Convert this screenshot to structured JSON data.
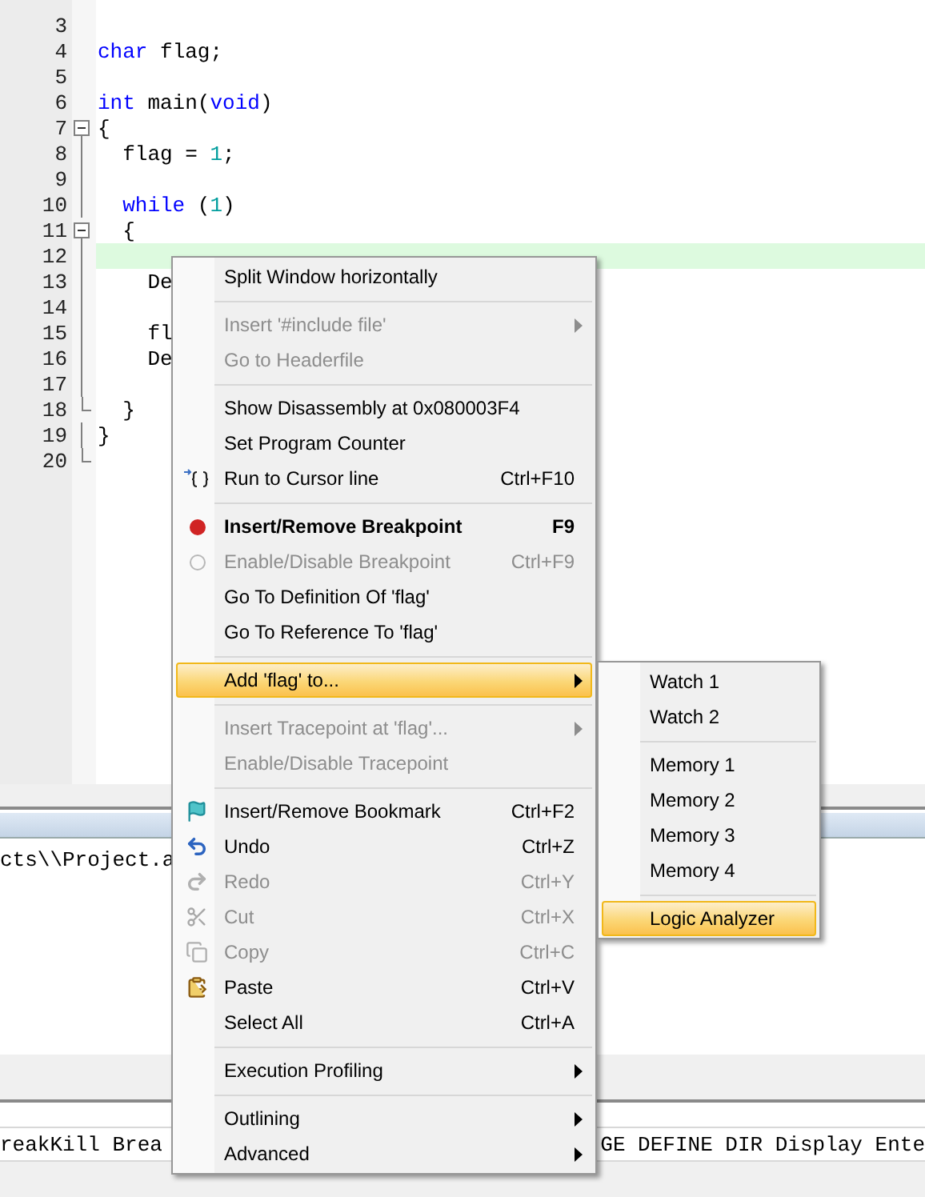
{
  "editor": {
    "lines": [
      {
        "number": "3",
        "highlighted": false
      },
      {
        "number": "4",
        "tokens": [
          {
            "kind": "kw",
            "text": "char"
          },
          {
            "kind": "plain",
            "text": " flag;"
          }
        ],
        "highlighted": false
      },
      {
        "number": "5",
        "highlighted": false
      },
      {
        "number": "6",
        "tokens": [
          {
            "kind": "kw",
            "text": "int"
          },
          {
            "kind": "plain",
            "text": " main("
          },
          {
            "kind": "kw",
            "text": "void"
          },
          {
            "kind": "plain",
            "text": ")"
          }
        ],
        "highlighted": false
      },
      {
        "number": "7",
        "tokens": [
          {
            "kind": "plain",
            "text": "{"
          }
        ],
        "fold_marker": {
          "kind": "toggle"
        },
        "highlighted": false
      },
      {
        "number": "8",
        "tokens": [
          {
            "kind": "plain",
            "text": "  flag = "
          },
          {
            "kind": "num",
            "text": "1"
          },
          {
            "kind": "plain",
            "text": ";"
          }
        ],
        "fold_marker": {
          "kind": "line"
        },
        "highlighted": false
      },
      {
        "number": "9",
        "fold_marker": {
          "kind": "line"
        },
        "highlighted": false
      },
      {
        "number": "10",
        "tokens": [
          {
            "kind": "kw",
            "text": "  while"
          },
          {
            "kind": "plain",
            "text": " ("
          },
          {
            "kind": "num",
            "text": "1"
          },
          {
            "kind": "plain",
            "text": ")"
          }
        ],
        "fold_marker": {
          "kind": "line"
        },
        "highlighted": false
      },
      {
        "number": "11",
        "tokens": [
          {
            "kind": "plain",
            "text": "  {"
          }
        ],
        "fold_marker": {
          "kind": "toggle"
        },
        "highlighted": false
      },
      {
        "number": "12",
        "fold_marker": {
          "kind": "line"
        },
        "highlighted": true
      },
      {
        "number": "13",
        "tokens": [
          {
            "kind": "plain",
            "text": "    De"
          }
        ],
        "fold_marker": {
          "kind": "line"
        },
        "highlighted": false
      },
      {
        "number": "14",
        "fold_marker": {
          "kind": "line"
        },
        "highlighted": false
      },
      {
        "number": "15",
        "tokens": [
          {
            "kind": "plain",
            "text": "    fl"
          }
        ],
        "fold_marker": {
          "kind": "line"
        },
        "highlighted": false
      },
      {
        "number": "16",
        "tokens": [
          {
            "kind": "plain",
            "text": "    De"
          }
        ],
        "fold_marker": {
          "kind": "line"
        },
        "highlighted": false
      },
      {
        "number": "17",
        "fold_marker": {
          "kind": "line"
        },
        "highlighted": false
      },
      {
        "number": "18",
        "tokens": [
          {
            "kind": "plain",
            "text": "  }"
          }
        ],
        "fold_marker": {
          "kind": "end"
        },
        "highlighted": false
      },
      {
        "number": "19",
        "tokens": [
          {
            "kind": "plain",
            "text": "}"
          }
        ],
        "fold_marker": {
          "kind": "line"
        },
        "highlighted": false
      },
      {
        "number": "20",
        "fold_marker": {
          "kind": "end"
        },
        "highlighted": false
      }
    ]
  },
  "output": {
    "text": "cts\\\\Project.a"
  },
  "command_line": {
    "left": "reakKill Brea",
    "right": "GE DEFINE DIR Display Ente"
  },
  "context_menu": {
    "items": [
      {
        "kind": "item",
        "label": "Split Window horizontally",
        "disabled": false,
        "selected": false,
        "bold": false,
        "submenu": false
      },
      {
        "kind": "separator"
      },
      {
        "kind": "item",
        "label": "Insert '#include file'",
        "disabled": true,
        "selected": false,
        "bold": false,
        "submenu": true
      },
      {
        "kind": "item",
        "label": "Go to Headerfile",
        "disabled": true,
        "selected": false,
        "bold": false,
        "submenu": false
      },
      {
        "kind": "separator"
      },
      {
        "kind": "item",
        "label": "Show Disassembly at 0x080003F4",
        "disabled": false,
        "selected": false,
        "bold": false,
        "submenu": false
      },
      {
        "kind": "item",
        "label": "Set Program Counter",
        "disabled": false,
        "selected": false,
        "bold": false,
        "submenu": false
      },
      {
        "kind": "item",
        "label": "Run to Cursor line",
        "shortcut": "Ctrl+F10",
        "disabled": false,
        "selected": false,
        "bold": false,
        "submenu": false
      },
      {
        "kind": "separator"
      },
      {
        "kind": "item",
        "label": "Insert/Remove Breakpoint",
        "shortcut": "F9",
        "disabled": false,
        "selected": false,
        "bold": true,
        "submenu": false
      },
      {
        "kind": "item",
        "label": "Enable/Disable Breakpoint",
        "shortcut": "Ctrl+F9",
        "disabled": true,
        "selected": false,
        "bold": false,
        "submenu": false
      },
      {
        "kind": "item",
        "label": "Go To Definition Of 'flag'",
        "disabled": false,
        "selected": false,
        "bold": false,
        "submenu": false
      },
      {
        "kind": "item",
        "label": "Go To Reference To 'flag'",
        "disabled": false,
        "selected": false,
        "bold": false,
        "submenu": false
      },
      {
        "kind": "separator"
      },
      {
        "kind": "item",
        "label": "Add 'flag' to...",
        "disabled": false,
        "selected": true,
        "bold": false,
        "submenu": true
      },
      {
        "kind": "separator"
      },
      {
        "kind": "item",
        "label": "Insert Tracepoint at 'flag'...",
        "disabled": true,
        "selected": false,
        "bold": false,
        "submenu": true
      },
      {
        "kind": "item",
        "label": "Enable/Disable Tracepoint",
        "disabled": true,
        "selected": false,
        "bold": false,
        "submenu": false
      },
      {
        "kind": "separator"
      },
      {
        "kind": "item",
        "label": "Insert/Remove Bookmark",
        "shortcut": "Ctrl+F2",
        "disabled": false,
        "selected": false,
        "bold": false,
        "submenu": false
      },
      {
        "kind": "item",
        "label": "Undo",
        "shortcut": "Ctrl+Z",
        "disabled": false,
        "selected": false,
        "bold": false,
        "submenu": false
      },
      {
        "kind": "item",
        "label": "Redo",
        "shortcut": "Ctrl+Y",
        "disabled": true,
        "selected": false,
        "bold": false,
        "submenu": false
      },
      {
        "kind": "item",
        "label": "Cut",
        "shortcut": "Ctrl+X",
        "disabled": true,
        "selected": false,
        "bold": false,
        "submenu": false
      },
      {
        "kind": "item",
        "label": "Copy",
        "shortcut": "Ctrl+C",
        "disabled": true,
        "selected": false,
        "bold": false,
        "submenu": false
      },
      {
        "kind": "item",
        "label": "Paste",
        "shortcut": "Ctrl+V",
        "disabled": false,
        "selected": false,
        "bold": false,
        "submenu": false
      },
      {
        "kind": "item",
        "label": "Select All",
        "shortcut": "Ctrl+A",
        "disabled": false,
        "selected": false,
        "bold": false,
        "submenu": false
      },
      {
        "kind": "separator"
      },
      {
        "kind": "item",
        "label": "Execution Profiling",
        "disabled": false,
        "selected": false,
        "bold": false,
        "submenu": true
      },
      {
        "kind": "separator"
      },
      {
        "kind": "item",
        "label": "Outlining",
        "disabled": false,
        "selected": false,
        "bold": false,
        "submenu": true
      },
      {
        "kind": "item",
        "label": "Advanced",
        "disabled": false,
        "selected": false,
        "bold": false,
        "submenu": true
      }
    ]
  },
  "submenu": {
    "items": [
      {
        "kind": "item",
        "label": "Watch 1",
        "disabled": false,
        "selected": false,
        "bold": false,
        "submenu": false
      },
      {
        "kind": "item",
        "label": "Watch 2",
        "disabled": false,
        "selected": false,
        "bold": false,
        "submenu": false
      },
      {
        "kind": "separator"
      },
      {
        "kind": "item",
        "label": "Memory 1",
        "disabled": false,
        "selected": false,
        "bold": false,
        "submenu": false
      },
      {
        "kind": "item",
        "label": "Memory 2",
        "disabled": false,
        "selected": false,
        "bold": false,
        "submenu": false
      },
      {
        "kind": "item",
        "label": "Memory 3",
        "disabled": false,
        "selected": false,
        "bold": false,
        "submenu": false
      },
      {
        "kind": "item",
        "label": "Memory 4",
        "disabled": false,
        "selected": false,
        "bold": false,
        "submenu": false
      },
      {
        "kind": "separator"
      },
      {
        "kind": "item",
        "label": "Logic Analyzer",
        "disabled": false,
        "selected": true,
        "bold": false,
        "submenu": false
      }
    ]
  }
}
